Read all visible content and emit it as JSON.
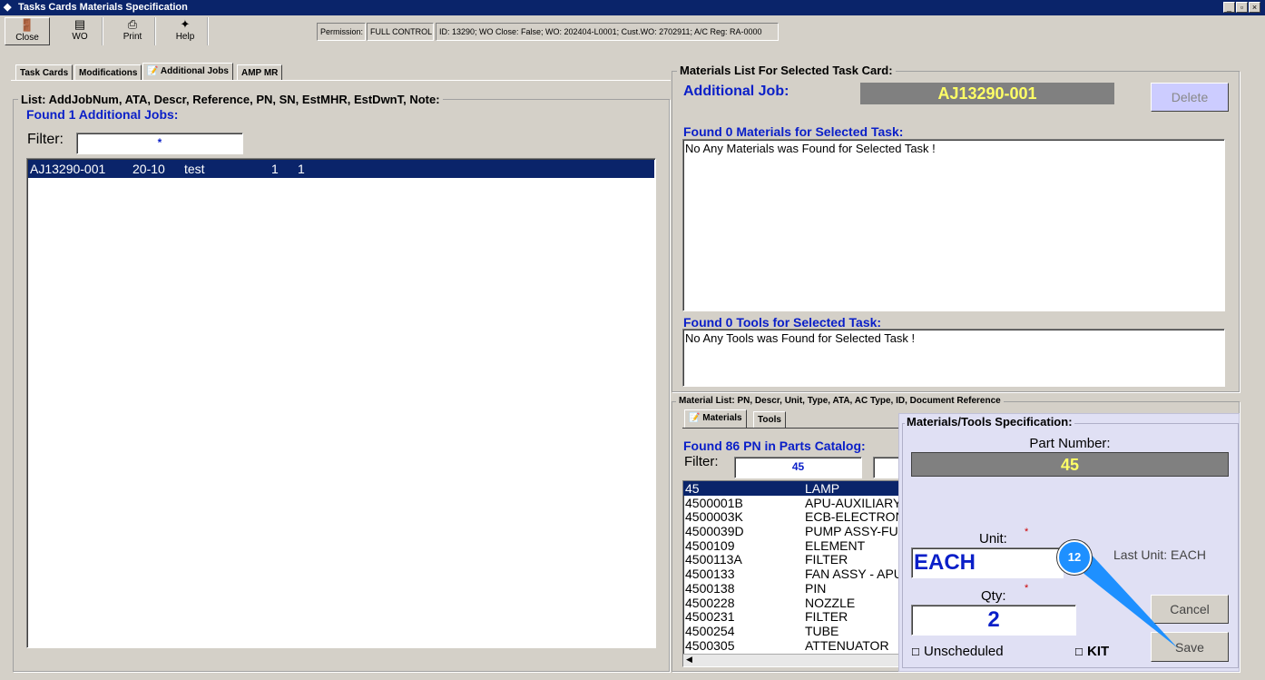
{
  "window": {
    "title": "Tasks Cards Materials Specification"
  },
  "toolbar": {
    "close": "Close",
    "wo": "WO",
    "print": "Print",
    "help": "Help"
  },
  "status": {
    "permission_label": "Permission:",
    "permission_value": "FULL CONTROL",
    "info": "ID: 13290; WO Close: False; WO: 202404-L0001; Cust.WO: 2702911; A/C Reg: RA-0000"
  },
  "tabs": [
    "Task Cards",
    "Modifications",
    "Additional Jobs",
    "AMP MR"
  ],
  "left": {
    "group_label": "List: AddJobNum, ATA, Descr, Reference, PN, SN, EstMHR, EstDwnT, Note:",
    "found": "Found 1 Additional Jobs:",
    "filter_label": "Filter:",
    "filter_value": "*",
    "rows": [
      {
        "num": "AJ13290-001",
        "ata": "20-10",
        "descr": "test",
        "a": "1",
        "b": "1"
      }
    ]
  },
  "right": {
    "group_label": "Materials List For Selected Task Card:",
    "job_label": "Additional Job:",
    "job_value": "AJ13290-001",
    "delete": "Delete",
    "materials_found": "Found 0 Materials for Selected Task:",
    "materials_msg": "No Any Materials was Found for Selected Task !",
    "tools_found": "Found 0 Tools for Selected Task:",
    "tools_msg": "No Any Tools was Found for Selected Task !"
  },
  "catalog": {
    "group_label": "Material List: PN, Descr, Unit, Type, ATA, AC Type, ID, Document Reference",
    "tabs": [
      "Materials",
      "Tools"
    ],
    "found": "Found 86 PN in Parts Catalog:",
    "filter_label": "Filter:",
    "filter_value": "45",
    "rows": [
      [
        "45",
        "LAMP"
      ],
      [
        "4500001B",
        "APU-AUXILIARY"
      ],
      [
        "4500003K",
        "ECB-ELECTRON"
      ],
      [
        "4500039D",
        "PUMP ASSY-FU"
      ],
      [
        "4500109",
        "ELEMENT"
      ],
      [
        "4500113A",
        "FILTER"
      ],
      [
        "4500133",
        "FAN ASSY - APU"
      ],
      [
        "4500138",
        "PIN"
      ],
      [
        "4500228",
        "NOZZLE"
      ],
      [
        "4500231",
        "FILTER"
      ],
      [
        "4500254",
        "TUBE"
      ],
      [
        "4500305",
        "ATTENUATOR"
      ]
    ]
  },
  "spec": {
    "title": "Materials/Tools Specification:",
    "pn_label": "Part Number:",
    "pn_value": "45",
    "unit_label": "Unit:",
    "unit_value": "EACH",
    "last_unit": "Last Unit: EACH",
    "qty_label": "Qty:",
    "qty_value": "2",
    "required": "*",
    "unscheduled": "Unscheduled",
    "kit": "KIT",
    "cancel": "Cancel",
    "save": "Save"
  },
  "callout": {
    "number": "12",
    "color": "#1e90ff"
  }
}
